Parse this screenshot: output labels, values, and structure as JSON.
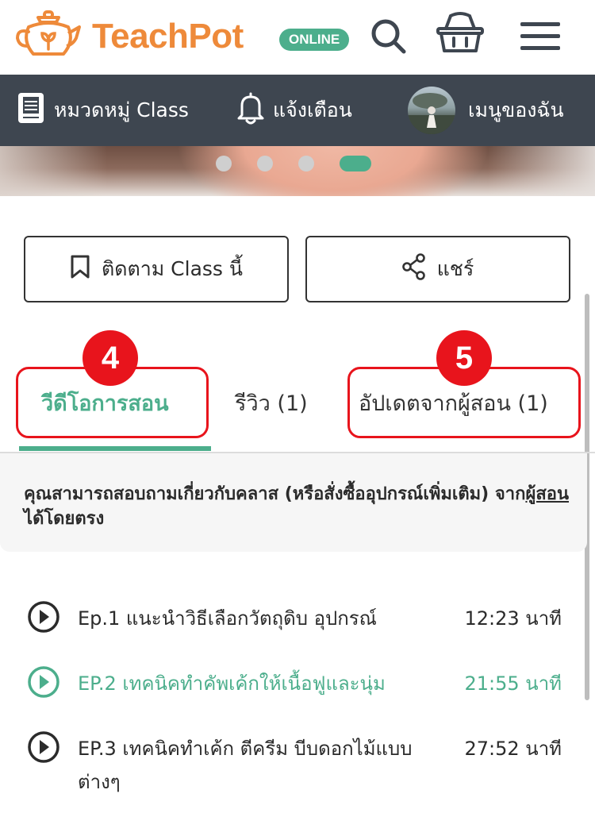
{
  "header": {
    "brand": "TeachPot",
    "badge": "ONLINE",
    "icons": [
      "teapot-logo-icon",
      "search-icon",
      "basket-icon",
      "hamburger-menu-icon"
    ]
  },
  "nav": {
    "category_label": "หมวดหมู่ Class",
    "notifications_label": "แจ้งเตือน",
    "my_menu_label": "เมนูของฉัน"
  },
  "carousel": {
    "total_slides": 4,
    "active_slide": 4
  },
  "actions": {
    "follow_label": "ติดตาม Class นี้",
    "share_label": "แชร์"
  },
  "tabs": [
    {
      "label": "วีดีโอการสอน",
      "active": true
    },
    {
      "label": "รีวิว (1)",
      "active": false
    },
    {
      "label": "อัปเดตจากผู้สอน (1)",
      "active": false
    }
  ],
  "annotations": {
    "video_tab_number": "4",
    "updates_tab_number": "5"
  },
  "info": {
    "text_before": "คุณสามารถสอบถามเกี่ยวกับคลาส (หรือสั่งซื้ออุปกรณ์เพิ่มเติม) จาก",
    "link_text": "ผู้สอน",
    "text_after": "ได้โดยตรง"
  },
  "episodes": [
    {
      "title": "Ep.1 แนะนำวิธีเลือกวัตถุดิบ อุปกรณ์",
      "duration": "12:23 นาที",
      "active": false
    },
    {
      "title": "EP.2 เทคนิคทำคัพเค้กให้เนื้อฟูและนุ่ม",
      "duration": "21:55 นาที",
      "active": true
    },
    {
      "title": "EP.3 เทคนิคทำเค้ก ตีครีม บีบดอกไม้แบบต่างๆ",
      "duration": "27:52 นาที",
      "active": false
    }
  ],
  "colors": {
    "brand_orange": "#ee8a3a",
    "accent_green": "#4cae8c",
    "nav_dark": "#3e4650",
    "annotation_red": "#e8141c"
  }
}
